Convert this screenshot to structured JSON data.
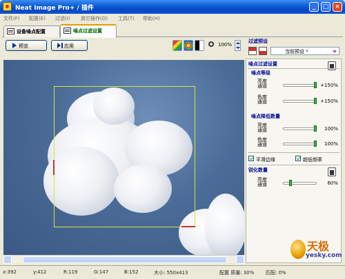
{
  "window": {
    "title": "Neat Image Pro+ / 插件"
  },
  "menu": [
    "文件(F)",
    "配置(E)",
    "过滤(I)",
    "其它操作(O)",
    "工具(T)",
    "帮助(H)"
  ],
  "tabs": [
    {
      "label": "设备噪点配置",
      "active": false
    },
    {
      "label": "噪点过滤设置",
      "active": true
    }
  ],
  "toolbar": {
    "preview_label": "预览",
    "apply_label": "应用",
    "zoom": "100%"
  },
  "status": {
    "x": "x:392",
    "y": "y:412",
    "r": "R:119",
    "g": "G:147",
    "b": "B:152",
    "size": "大小: 550x413",
    "profile": "配置 质量: 30%",
    "match": "匹配: 0%"
  },
  "panel": {
    "filter_preset_title": "过滤预设",
    "preset_value": "当前预设 *",
    "noise_filter_title": "噪点过滤设置",
    "noise_level_title": "噪点等级",
    "noise_reduction_title": "噪点降低数量",
    "sharpen_title": "锐化数量",
    "luma_label": "亮度\n通道",
    "chroma_label": "色度\n通道",
    "noise_level": {
      "luma": "+150%",
      "chroma": "+150%",
      "luma_fill": 1.0,
      "chroma_fill": 1.0
    },
    "noise_reduction": {
      "luma": "100%",
      "chroma": "100%",
      "luma_fill": 1.0,
      "chroma_fill": 1.0
    },
    "sharpen": {
      "luma": "60%",
      "luma_fill": 0.6
    },
    "smooth_edges_label": "平滑边缘",
    "ultra_low_freq_label": "超低频率",
    "smooth_edges_checked": true,
    "ultra_low_freq_checked": true
  },
  "watermark": {
    "brand": "天极",
    "site": "yesky.com"
  },
  "colors": {
    "accent_green": "#3db14a",
    "title_blue": "#000b94",
    "titlebar": "#0a5bd6"
  }
}
